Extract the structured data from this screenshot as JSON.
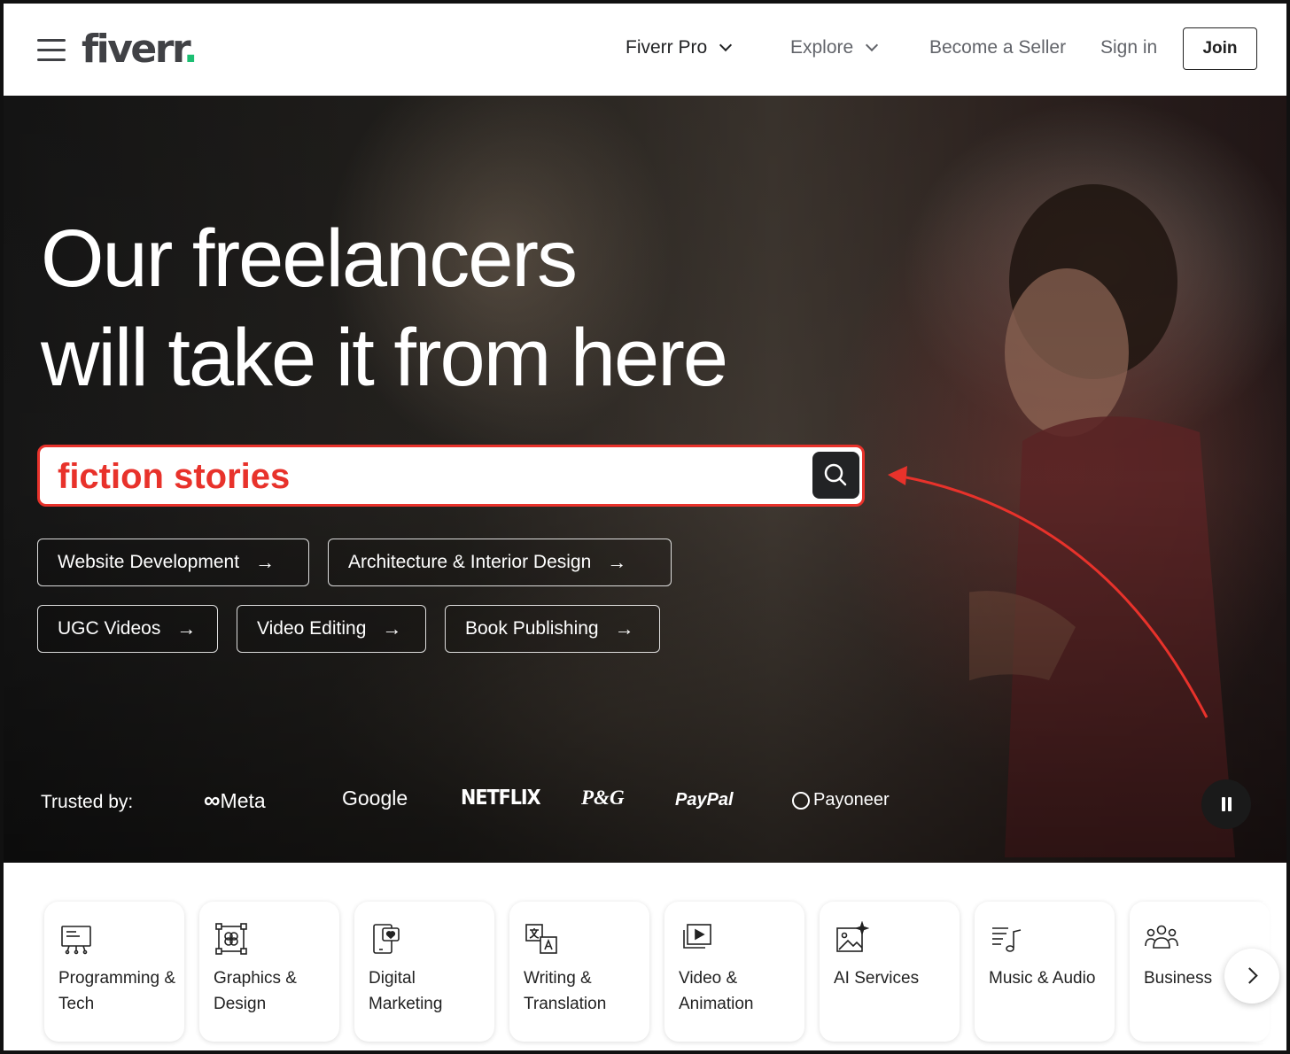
{
  "header": {
    "logo_text": "fiverr",
    "logo_dot": ".",
    "nav": [
      {
        "label": "Fiverr Pro",
        "has_dropdown": true
      },
      {
        "label": "Explore",
        "has_dropdown": true
      },
      {
        "label": "Become a Seller"
      },
      {
        "label": "Sign in"
      }
    ],
    "join_label": "Join"
  },
  "hero": {
    "headline_line1": "Our freelancers",
    "headline_line2": "will take it from here",
    "search_value": "fiction stories",
    "search_accent_color": "#e8322b",
    "chips": [
      {
        "label": "Website Development"
      },
      {
        "label": "Architecture & Interior Design"
      },
      {
        "label": "UGC Videos"
      },
      {
        "label": "Video Editing"
      },
      {
        "label": "Book Publishing"
      }
    ],
    "trusted_label": "Trusted by:",
    "brands": [
      "Meta",
      "Google",
      "NETFLIX",
      "P&G",
      "PayPal",
      "Payoneer"
    ]
  },
  "categories": [
    {
      "label": "Programming & Tech",
      "icon": "monitor-icon"
    },
    {
      "label": "Graphics & Design",
      "icon": "design-frame-icon"
    },
    {
      "label": "Digital Marketing",
      "icon": "phone-heart-icon"
    },
    {
      "label": "Writing & Translation",
      "icon": "translate-icon"
    },
    {
      "label": "Video & Animation",
      "icon": "video-play-icon"
    },
    {
      "label": "AI Services",
      "icon": "ai-image-icon"
    },
    {
      "label": "Music & Audio",
      "icon": "music-icon"
    },
    {
      "label": "Business",
      "icon": "people-icon"
    }
  ],
  "colors": {
    "brand_green": "#1dbf73",
    "search_border": "#e8322b",
    "dark": "#222325"
  }
}
